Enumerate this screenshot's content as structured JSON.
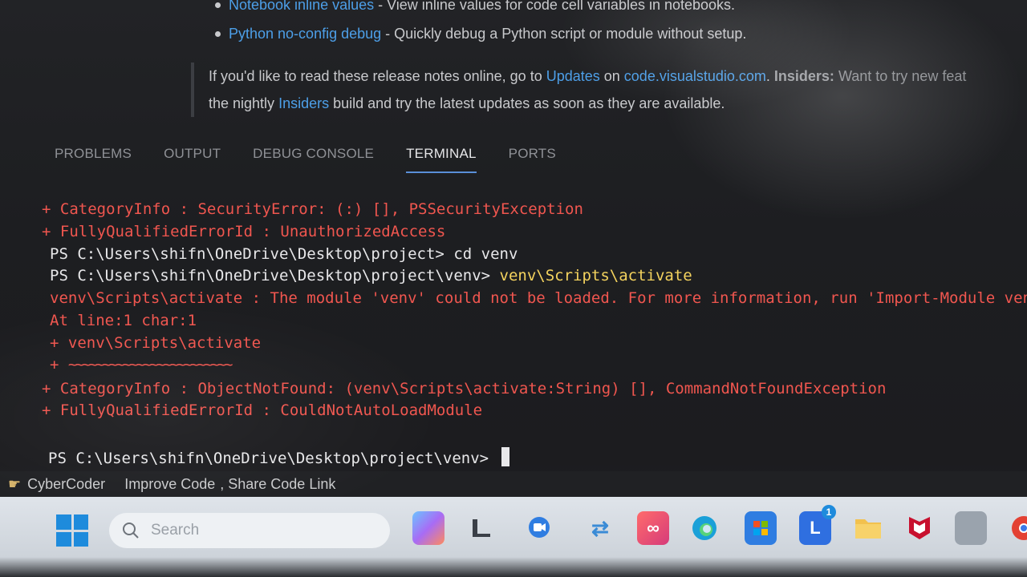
{
  "release_notes": {
    "bullet_1_link": "Notebook inline values",
    "bullet_1_text": " - View inline values for code cell variables in notebooks.",
    "bullet_2_link": "Python no-config debug",
    "bullet_2_text": " - Quickly debug a Python script or module without setup.",
    "para_part1": "If you'd like to read these release notes online, go to ",
    "para_link_updates": "Updates",
    "para_part2": " on ",
    "para_link_site": "code.visualstudio.com",
    "para_part3": ". ",
    "para_insiders_bold": "Insiders:",
    "para_part4": " Want to try new feat",
    "para_line2_part1": "the nightly ",
    "para_link_insiders": "Insiders",
    "para_line2_part2": " build and try the latest updates as soon as they are available."
  },
  "panel": {
    "tabs": [
      "PROBLEMS",
      "OUTPUT",
      "DEBUG CONSOLE",
      "TERMINAL",
      "PORTS"
    ],
    "active_tab": "TERMINAL"
  },
  "terminal": {
    "line_category_1_label": "    + CategoryInfo          ",
    "line_category_1_value": ": SecurityError: (:) [], PSSecurityException",
    "line_fqe_1_label": "    + FullyQualifiedErrorId ",
    "line_fqe_1_value": ": UnauthorizedAccess",
    "prompt_1": "PS C:\\Users\\shifn\\OneDrive\\Desktop\\project> ",
    "cmd_1": "cd venv",
    "prompt_2": "PS C:\\Users\\shifn\\OneDrive\\Desktop\\project\\venv> ",
    "cmd_2": "venv\\Scripts\\activate",
    "error_main": "venv\\Scripts\\activate : The module 'venv' could not be loaded. For more information, run 'Import-Module venv'",
    "error_at": "At line:1 char:1",
    "error_plus_cmd": "+ venv\\Scripts\\activate",
    "error_plus": "+ ",
    "error_squiggle": "~~~~~~~~~~~~~~~~~~~~~~~~",
    "line_category_2_label": "    + CategoryInfo          ",
    "line_category_2_value": ": ObjectNotFound: (venv\\Scripts\\activate:String) [], CommandNotFoundException",
    "line_fqe_2_label": "    + FullyQualifiedErrorId ",
    "line_fqe_2_value": ": CouldNotAutoLoadModule",
    "prompt_3": "PS C:\\Users\\shifn\\OneDrive\\Desktop\\project\\venv> "
  },
  "statusbar": {
    "item_1": "CyberCoder",
    "item_2": "Improve Code",
    "item_3": ", Share Code Link"
  },
  "taskbar": {
    "search_placeholder": "Search",
    "icons": [
      "windows-start-icon",
      "copilot-icon",
      "file-explorer-icon",
      "chat-icon",
      "sync-icon",
      "creative-cloud-icon",
      "edge-icon",
      "store-icon",
      "teams-l-icon",
      "folder-icon",
      "mcafee-icon",
      "app-icon",
      "chrome-icon"
    ],
    "teams_badge": "1"
  },
  "colors": {
    "error_red": "#f0564f",
    "command_yellow": "#f4d35e",
    "link_blue": "#4d9fe8",
    "active_tab_underline": "#5a8fd8"
  }
}
